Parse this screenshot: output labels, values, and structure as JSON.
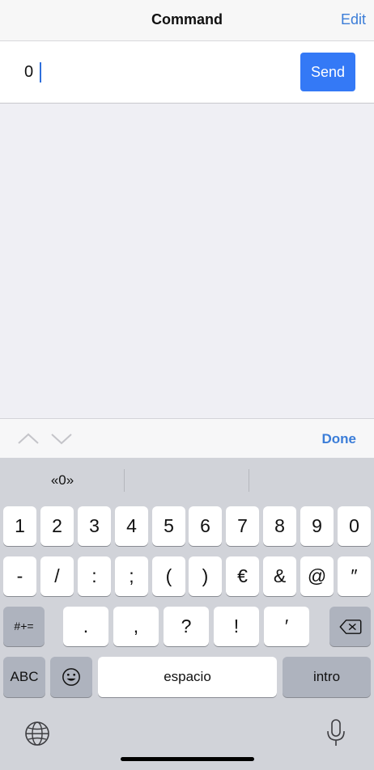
{
  "nav": {
    "title": "Command",
    "edit_label": "Edit"
  },
  "command": {
    "value": "0",
    "send_label": "Send"
  },
  "accessory": {
    "up_icon": "chevron-up-icon",
    "down_icon": "chevron-down-icon",
    "done_label": "Done"
  },
  "keyboard": {
    "suggestions": [
      "«0»",
      "",
      ""
    ],
    "row1": [
      "1",
      "2",
      "3",
      "4",
      "5",
      "6",
      "7",
      "8",
      "9",
      "0"
    ],
    "row2": [
      "-",
      "/",
      ":",
      ";",
      "(",
      ")",
      "€",
      "&",
      "@",
      "″"
    ],
    "row3": {
      "shift_label": "#+=",
      "keys": [
        ".",
        ",",
        "?",
        "!",
        "′"
      ],
      "delete_icon": "backspace-icon"
    },
    "row4": {
      "abc_label": "ABC",
      "emoji_icon": "emoji-icon",
      "space_label": "espacio",
      "return_label": "intro"
    },
    "globe_icon": "globe-icon",
    "mic_icon": "microphone-icon"
  }
}
